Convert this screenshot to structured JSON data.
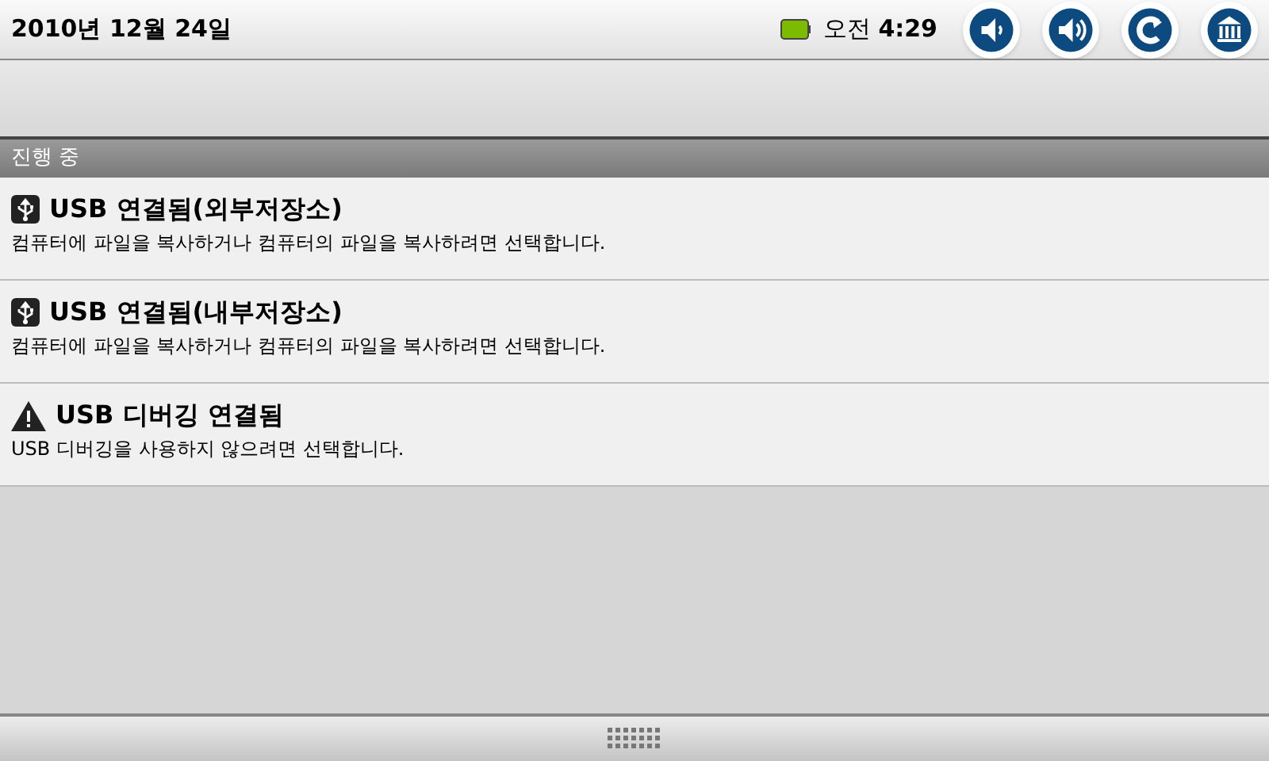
{
  "status_bar": {
    "date": "2010년 12월 24일",
    "time": "오전 **4:29**",
    "buttons": [
      {
        "kind": "volume-down"
      },
      {
        "kind": "volume-up"
      },
      {
        "kind": "back"
      },
      {
        "kind": "home"
      }
    ]
  },
  "section": {
    "title": "진행 중"
  },
  "notifications": [
    {
      "kind": "usb",
      "title": "USB 연결됨(외부저장소)",
      "text": "컴퓨터에 파일을 복사하거나 컴퓨터의 파일을 복사하려면 선택합니다."
    },
    {
      "kind": "usb",
      "title": "USB 연결됨(내부저장소)",
      "text": "컴퓨터에 파일을 복사하거나 컴퓨터의 파일을 복사하려면 선택합니다."
    },
    {
      "kind": "warning",
      "title": "USB 디버깅 연결됨",
      "text": "USB 디버깅을 사용하지 않으려면 선택합니다."
    }
  ]
}
